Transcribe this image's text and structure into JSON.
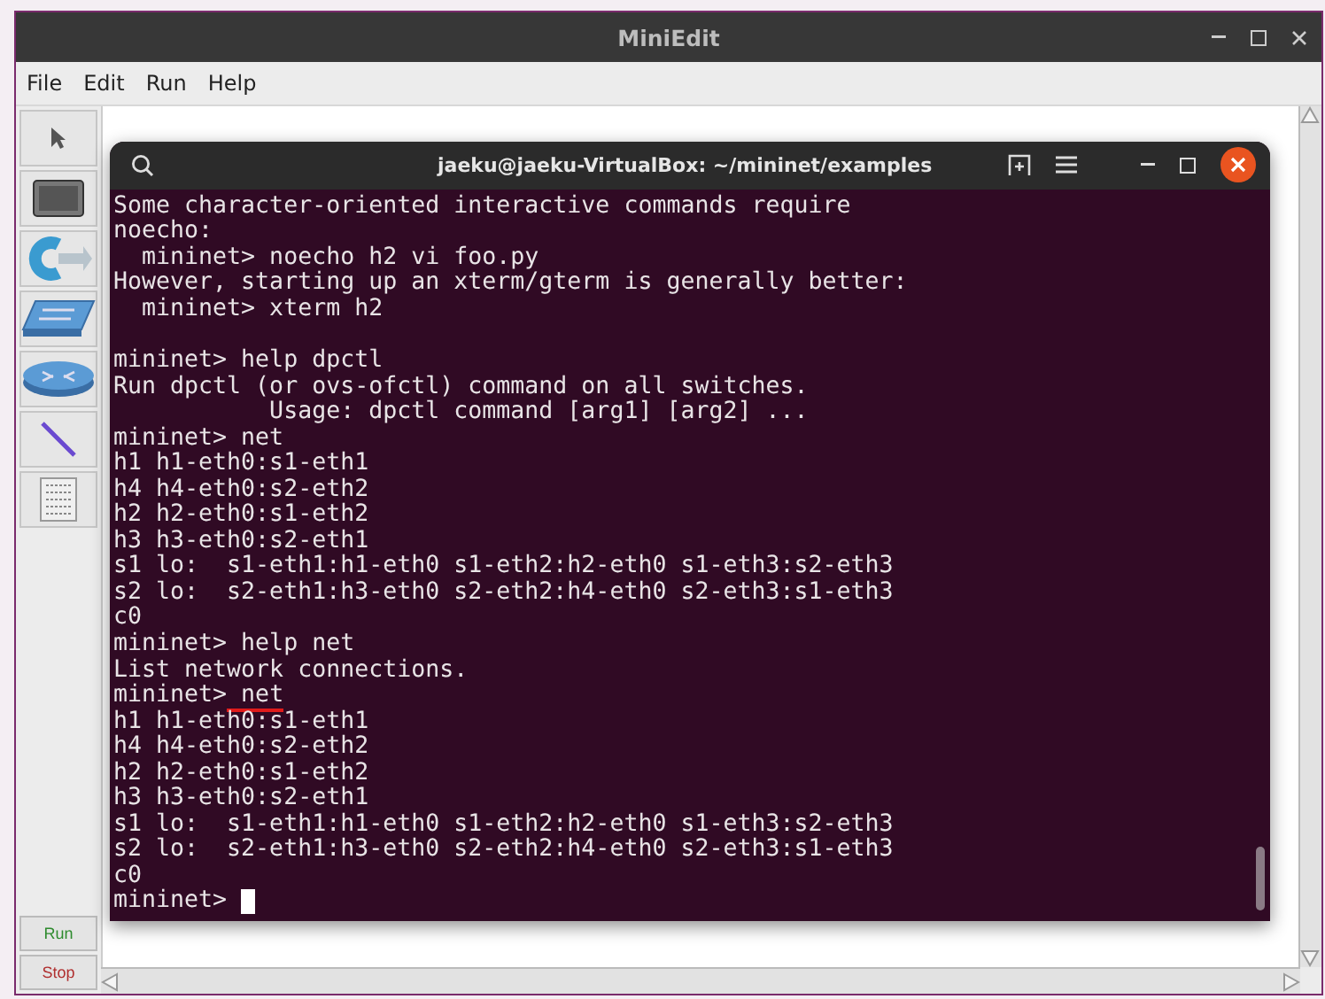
{
  "window": {
    "title": "MiniEdit"
  },
  "menu": [
    "File",
    "Edit",
    "Run",
    "Help"
  ],
  "tools": [
    {
      "kind": "select"
    },
    {
      "kind": "host"
    },
    {
      "kind": "controller"
    },
    {
      "kind": "switch"
    },
    {
      "kind": "router"
    },
    {
      "kind": "link"
    },
    {
      "kind": "netlink"
    }
  ],
  "run_buttons": [
    {
      "label": "Run",
      "color": "#2e8b2e"
    },
    {
      "label": "Stop",
      "color": "#b03030"
    }
  ],
  "terminal": {
    "title": "jaeku@jaeku-VirtualBox: ~/mininet/examples",
    "lines": [
      {
        "kind": "text",
        "text": "Some character-oriented interactive commands require"
      },
      {
        "kind": "text",
        "text": "noecho:"
      },
      {
        "kind": "text",
        "text": "  mininet> noecho h2 vi foo.py"
      },
      {
        "kind": "text",
        "text": "However, starting up an xterm/gterm is generally better:"
      },
      {
        "kind": "text",
        "text": "  mininet> xterm h2"
      },
      {
        "kind": "blank"
      },
      {
        "kind": "text",
        "text": "mininet> help dpctl"
      },
      {
        "kind": "text",
        "text": "Run dpctl (or ovs-ofctl) command on all switches."
      },
      {
        "kind": "text",
        "text": "           Usage: dpctl command [arg1] [arg2] ..."
      },
      {
        "kind": "text",
        "text": "mininet> net"
      },
      {
        "kind": "text",
        "text": "h1 h1-eth0:s1-eth1"
      },
      {
        "kind": "text",
        "text": "h4 h4-eth0:s2-eth2"
      },
      {
        "kind": "text",
        "text": "h2 h2-eth0:s1-eth2"
      },
      {
        "kind": "text",
        "text": "h3 h3-eth0:s2-eth1"
      },
      {
        "kind": "text",
        "text": "s1 lo:  s1-eth1:h1-eth0 s1-eth2:h2-eth0 s1-eth3:s2-eth3"
      },
      {
        "kind": "text",
        "text": "s2 lo:  s2-eth1:h3-eth0 s2-eth2:h4-eth0 s2-eth3:s1-eth3"
      },
      {
        "kind": "text",
        "text": "c0"
      },
      {
        "kind": "text",
        "text": "mininet> help net"
      },
      {
        "kind": "text",
        "text": "List network connections."
      },
      {
        "kind": "marked",
        "text": "mininet>",
        "marked": " net"
      },
      {
        "kind": "text",
        "text": "h1 h1-eth0:s1-eth1"
      },
      {
        "kind": "text",
        "text": "h4 h4-eth0:s2-eth2"
      },
      {
        "kind": "text",
        "text": "h2 h2-eth0:s1-eth2"
      },
      {
        "kind": "text",
        "text": "h3 h3-eth0:s2-eth1"
      },
      {
        "kind": "text",
        "text": "s1 lo:  s1-eth1:h1-eth0 s1-eth2:h2-eth0 s1-eth3:s2-eth3"
      },
      {
        "kind": "text",
        "text": "s2 lo:  s2-eth1:h3-eth0 s2-eth2:h4-eth0 s2-eth3:s1-eth3"
      },
      {
        "kind": "text",
        "text": "c0"
      },
      {
        "kind": "prompt",
        "text": "mininet>",
        "cursor": true
      }
    ]
  }
}
